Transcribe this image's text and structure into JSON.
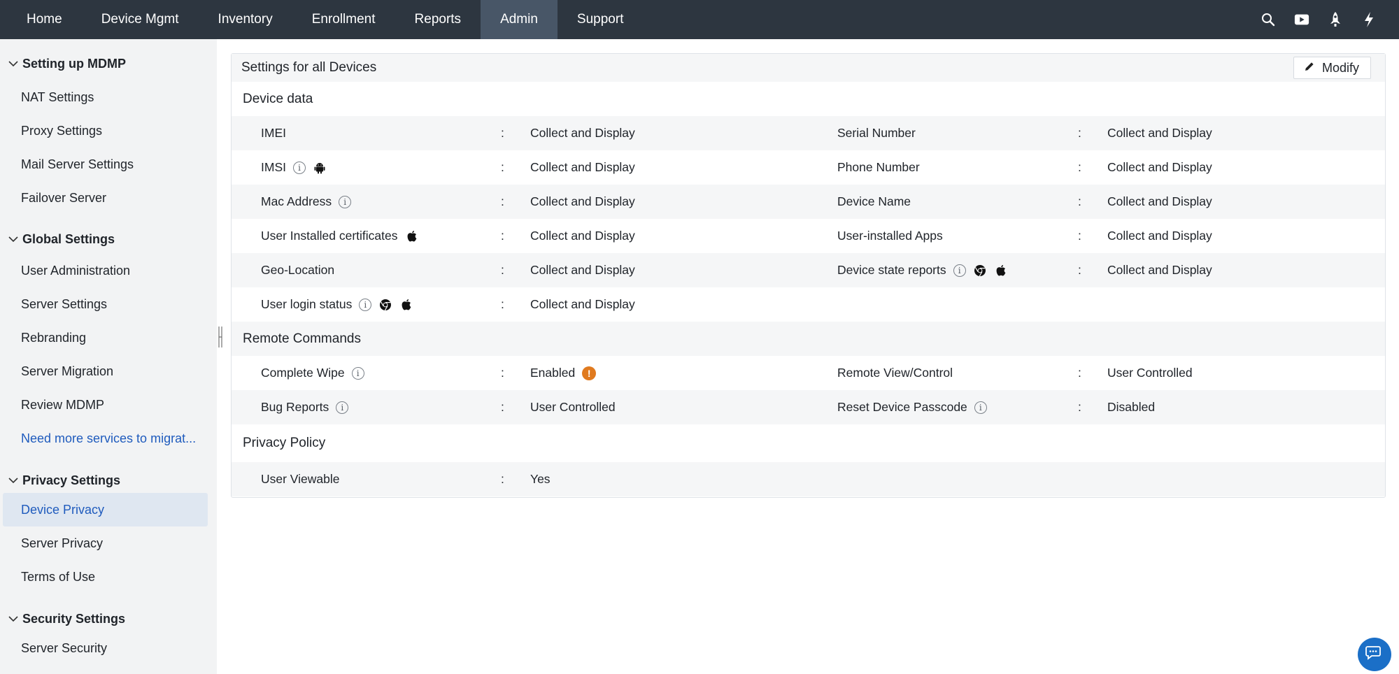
{
  "nav": {
    "tabs": [
      {
        "label": "Home"
      },
      {
        "label": "Device Mgmt"
      },
      {
        "label": "Inventory"
      },
      {
        "label": "Enrollment"
      },
      {
        "label": "Reports"
      },
      {
        "label": "Admin"
      },
      {
        "label": "Support"
      }
    ],
    "active_tab": "Admin",
    "icons": [
      "search-icon",
      "video-icon",
      "rocket-icon",
      "lightning-icon"
    ]
  },
  "sidebar": {
    "groups": [
      {
        "title": "Setting up MDMP",
        "items": [
          "NAT Settings",
          "Proxy Settings",
          "Mail Server Settings",
          "Failover Server"
        ]
      },
      {
        "title": "Global Settings",
        "items": [
          "User Administration",
          "Server Settings",
          "Rebranding",
          "Server Migration",
          "Review MDMP",
          "Need more services to migrat..."
        ]
      },
      {
        "title": "Privacy Settings",
        "items": [
          "Device Privacy",
          "Server Privacy",
          "Terms of Use"
        ]
      },
      {
        "title": "Security Settings",
        "items": [
          "Server Security"
        ]
      }
    ],
    "selected_item": "Device Privacy"
  },
  "panel": {
    "title": "Settings for all Devices",
    "modify_label": "Modify",
    "colon": ":",
    "sections": {
      "device_data": {
        "title": "Device data",
        "rows": [
          {
            "l1": "IMEI",
            "v1": "Collect and Display",
            "l2": "Serial Number",
            "v2": "Collect and Display"
          },
          {
            "l1": "IMSI",
            "v1": "Collect and Display",
            "l2": "Phone Number",
            "v2": "Collect and Display"
          },
          {
            "l1": "Mac Address",
            "v1": "Collect and Display",
            "l2": "Device Name",
            "v2": "Collect and Display"
          },
          {
            "l1": "User Installed certificates",
            "v1": "Collect and Display",
            "l2": "User-installed Apps",
            "v2": "Collect and Display"
          },
          {
            "l1": "Geo-Location",
            "v1": "Collect and Display",
            "l2": "Device state reports",
            "v2": "Collect and Display"
          },
          {
            "l1": "User login status",
            "v1": "Collect and Display"
          }
        ]
      },
      "remote_commands": {
        "title": "Remote Commands",
        "rows": [
          {
            "l1": "Complete Wipe",
            "v1": "Enabled",
            "l2": "Remote View/Control",
            "v2": "User Controlled"
          },
          {
            "l1": "Bug Reports",
            "v1": "User Controlled",
            "l2": "Reset Device Passcode",
            "v2": "Disabled"
          }
        ]
      },
      "privacy_policy": {
        "title": "Privacy Policy",
        "rows": [
          {
            "l1": "User Viewable",
            "v1": "Yes"
          }
        ]
      }
    }
  },
  "colors": {
    "nav_bg": "#2d3640",
    "nav_active": "#485667",
    "link": "#1f5bbd",
    "selected_bg": "#dfe7f1",
    "warning": "#e07a1f",
    "chat": "#1b6fc7"
  }
}
